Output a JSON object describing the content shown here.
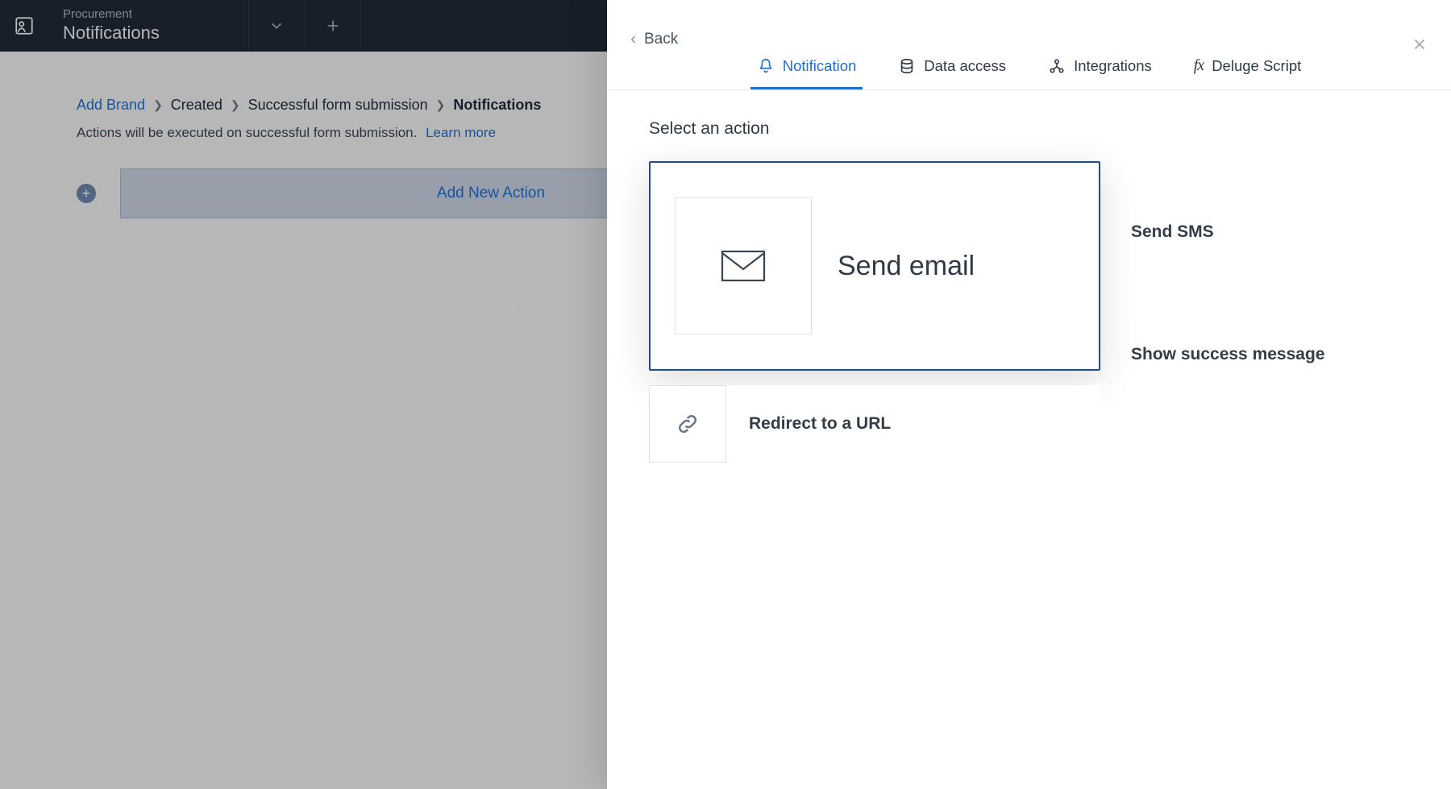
{
  "topbar": {
    "supertitle": "Procurement",
    "title": "Notifications"
  },
  "breadcrumb": {
    "items": [
      {
        "label": "Add Brand",
        "link": true
      },
      {
        "label": "Created"
      },
      {
        "label": "Successful form submission"
      },
      {
        "label": "Notifications",
        "strong": true
      }
    ],
    "subline": "Actions will be executed on successful form submission.",
    "learn_more": "Learn more"
  },
  "add_action": {
    "label": "Add New Action"
  },
  "panel": {
    "back": "Back",
    "tabs": {
      "notification": "Notification",
      "data_access": "Data access",
      "integrations": "Integrations",
      "deluge": "Deluge Script"
    },
    "heading": "Select an action",
    "actions": {
      "send_email": "Send email",
      "send_sms": "Send SMS",
      "show_success": "Show success message",
      "redirect": "Redirect to a URL"
    }
  }
}
